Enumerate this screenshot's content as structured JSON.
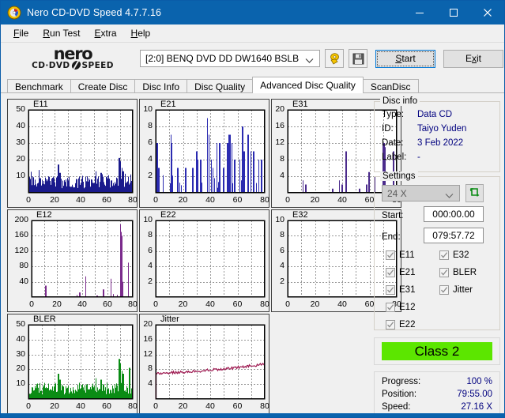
{
  "window": {
    "title": "Nero CD-DVD Speed 4.7.7.16",
    "icon": "nero-disc-icon",
    "minimize_label": "–",
    "maximize_label": "□",
    "close_label": "✕"
  },
  "menu": [
    {
      "label": "File",
      "accel": "F"
    },
    {
      "label": "Run Test",
      "accel": "R"
    },
    {
      "label": "Extra",
      "accel": "E"
    },
    {
      "label": "Help",
      "accel": "H"
    }
  ],
  "logo": {
    "line1": "nero",
    "line2_left": "CD·DVD",
    "line2_right": "SPEED"
  },
  "toolbar": {
    "drive_value": "[2:0]   BENQ DVD DD DW1640 BSLB",
    "eject_icon": "eject-disc-icon",
    "save_icon": "floppy-save-icon",
    "start_label": "Start",
    "start_accel": "S",
    "exit_label": "Exit",
    "exit_accel": "x"
  },
  "tabs": [
    {
      "label": "Benchmark",
      "active": false
    },
    {
      "label": "Create Disc",
      "active": false
    },
    {
      "label": "Disc Info",
      "active": false
    },
    {
      "label": "Disc Quality",
      "active": false
    },
    {
      "label": "Advanced Disc Quality",
      "active": true
    },
    {
      "label": "ScanDisc",
      "active": false
    }
  ],
  "disc_info": {
    "legend": "Disc info",
    "rows": [
      {
        "label": "Type:",
        "value": "Data CD"
      },
      {
        "label": "ID:",
        "value": "Taiyo Yuden"
      },
      {
        "label": "Date:",
        "value": "3 Feb 2022"
      },
      {
        "label": "Label:",
        "value": "-"
      }
    ]
  },
  "settings": {
    "legend": "Settings",
    "speed_value": "24 X",
    "refresh_icon": "refresh-icon",
    "start_label": "Start:",
    "start_value": "000:00.00",
    "end_label": "End:",
    "end_value": "079:57.72",
    "checkboxes_col1": [
      {
        "label": "E11",
        "checked": true
      },
      {
        "label": "E21",
        "checked": true
      },
      {
        "label": "E31",
        "checked": true
      },
      {
        "label": "E12",
        "checked": true
      },
      {
        "label": "E22",
        "checked": true
      }
    ],
    "checkboxes_col2": [
      {
        "label": "E32",
        "checked": true
      },
      {
        "label": "BLER",
        "checked": true
      },
      {
        "label": "Jitter",
        "checked": true
      }
    ]
  },
  "quality": {
    "class_label": "Class 2",
    "class_color": "#5ce600"
  },
  "status": {
    "rows": [
      {
        "label": "Progress:",
        "value": "100 %"
      },
      {
        "label": "Position:",
        "value": "79:55.00"
      },
      {
        "label": "Speed:",
        "value": "27.16 X"
      }
    ]
  },
  "chart_data": [
    {
      "id": "e11",
      "type": "area",
      "title": "E11",
      "color": "#1a1a8c",
      "xlabel": "",
      "ylabel": "",
      "xlim": [
        0,
        80
      ],
      "ylim": [
        0,
        50
      ],
      "xticks": [
        0,
        20,
        40,
        60,
        80
      ],
      "yticks": [
        10,
        20,
        30,
        40,
        50
      ],
      "grid": true,
      "seed": 11,
      "baseline": 6.5,
      "noise": 4.2,
      "spikes": [
        [
          23,
          17
        ],
        [
          24,
          12
        ],
        [
          52,
          13
        ],
        [
          56,
          12
        ],
        [
          70,
          21
        ],
        [
          71,
          19
        ],
        [
          72,
          15
        ],
        [
          73,
          13
        ]
      ],
      "peak_values_note": "dense noise floor ~3-10, spikes to 17 at x=23 and 21 at x=71"
    },
    {
      "id": "e21",
      "type": "bar",
      "title": "E21",
      "color": "#2b2bb0",
      "xlim": [
        0,
        80
      ],
      "ylim": [
        0,
        10
      ],
      "xticks": [
        0,
        20,
        40,
        60,
        80
      ],
      "yticks": [
        2,
        4,
        6,
        8,
        10
      ],
      "grid": true,
      "seed": 21,
      "baseline": 0.6,
      "noise": 1.6,
      "spikes": [
        [
          1,
          6
        ],
        [
          2,
          3
        ],
        [
          11,
          7
        ],
        [
          11.5,
          6
        ],
        [
          16,
          3
        ],
        [
          22,
          3
        ],
        [
          27,
          3
        ],
        [
          30,
          5
        ],
        [
          31,
          4
        ],
        [
          33,
          4
        ],
        [
          38,
          9
        ],
        [
          39,
          7
        ],
        [
          41,
          4
        ],
        [
          42,
          3
        ],
        [
          45,
          6
        ],
        [
          47,
          6
        ],
        [
          50,
          3
        ],
        [
          53,
          6
        ],
        [
          54,
          7
        ],
        [
          55,
          7
        ],
        [
          56,
          6
        ],
        [
          58,
          4
        ],
        [
          62,
          4
        ],
        [
          64,
          8
        ],
        [
          65,
          5
        ],
        [
          68,
          7
        ],
        [
          70,
          5
        ],
        [
          72,
          5
        ],
        [
          76,
          4
        ],
        [
          78,
          4
        ]
      ]
    },
    {
      "id": "e31",
      "type": "bar",
      "title": "E31",
      "color": "#4b2b8c",
      "xlim": [
        0,
        80
      ],
      "ylim": [
        0,
        20
      ],
      "xticks": [
        0,
        20,
        40,
        60,
        80
      ],
      "yticks": [
        4,
        8,
        12,
        16,
        20
      ],
      "grid": true,
      "seed": 31,
      "baseline": 0,
      "noise": 0,
      "spikes": [
        [
          11,
          3
        ],
        [
          13,
          2
        ],
        [
          33,
          1
        ],
        [
          38,
          3
        ],
        [
          40,
          2
        ],
        [
          43,
          10
        ],
        [
          53,
          1
        ],
        [
          58,
          2
        ],
        [
          60,
          5
        ],
        [
          64,
          4
        ],
        [
          70,
          12
        ],
        [
          70.8,
          12
        ],
        [
          71.5,
          11
        ],
        [
          73,
          1
        ],
        [
          74,
          1
        ],
        [
          78,
          10
        ]
      ]
    },
    {
      "id": "e12",
      "type": "bar",
      "title": "E12",
      "color": "#7b2b8c",
      "xlim": [
        0,
        80
      ],
      "ylim": [
        0,
        200
      ],
      "xticks": [
        0,
        20,
        40,
        60,
        80
      ],
      "yticks": [
        40,
        80,
        120,
        160,
        200
      ],
      "grid": true,
      "seed": 12,
      "baseline": 0,
      "noise": 0,
      "spikes": [
        [
          11,
          30
        ],
        [
          36,
          6
        ],
        [
          38,
          12
        ],
        [
          43,
          54
        ],
        [
          52,
          4
        ],
        [
          57,
          20
        ],
        [
          63,
          48
        ],
        [
          65,
          8
        ],
        [
          68,
          6
        ],
        [
          70.5,
          190
        ],
        [
          71,
          170
        ],
        [
          71.5,
          160
        ],
        [
          72,
          40
        ],
        [
          77,
          90
        ]
      ]
    },
    {
      "id": "e22",
      "type": "bar",
      "title": "E22",
      "color": "#2b2bb0",
      "xlim": [
        0,
        80
      ],
      "ylim": [
        0,
        10
      ],
      "xticks": [
        0,
        20,
        40,
        60,
        80
      ],
      "yticks": [
        2,
        4,
        6,
        8,
        10
      ],
      "grid": true,
      "seed": 22,
      "baseline": 0,
      "noise": 0,
      "spikes": []
    },
    {
      "id": "e32",
      "type": "bar",
      "title": "E32",
      "color": "#4b2b8c",
      "xlim": [
        0,
        80
      ],
      "ylim": [
        0,
        10
      ],
      "xticks": [
        0,
        20,
        40,
        60,
        80
      ],
      "yticks": [
        2,
        4,
        6,
        8,
        10
      ],
      "grid": true,
      "seed": 32,
      "baseline": 0,
      "noise": 0,
      "spikes": []
    },
    {
      "id": "bler",
      "type": "area",
      "title": "BLER",
      "color": "#0a8c14",
      "xlim": [
        0,
        80
      ],
      "ylim": [
        0,
        50
      ],
      "xticks": [
        0,
        20,
        40,
        60,
        80
      ],
      "yticks": [
        10,
        20,
        30,
        40,
        50
      ],
      "grid": true,
      "seed": 99,
      "baseline": 7.0,
      "noise": 4.5,
      "spikes": [
        [
          0,
          17
        ],
        [
          23,
          17
        ],
        [
          24,
          13
        ],
        [
          52,
          14
        ],
        [
          56,
          13
        ],
        [
          70,
          27
        ],
        [
          71,
          24
        ],
        [
          72,
          19
        ],
        [
          73,
          17
        ],
        [
          78,
          21
        ]
      ]
    },
    {
      "id": "jitter",
      "type": "line",
      "title": "Jitter",
      "color": "#9e1b52",
      "xlim": [
        0,
        80
      ],
      "ylim": [
        0,
        20
      ],
      "xticks": [
        0,
        20,
        40,
        60,
        80
      ],
      "yticks": [
        4,
        8,
        12,
        16,
        20
      ],
      "grid": true,
      "seed": 77,
      "trend_start": 7.0,
      "trend_end": 9.4,
      "noise": 0.35
    }
  ]
}
